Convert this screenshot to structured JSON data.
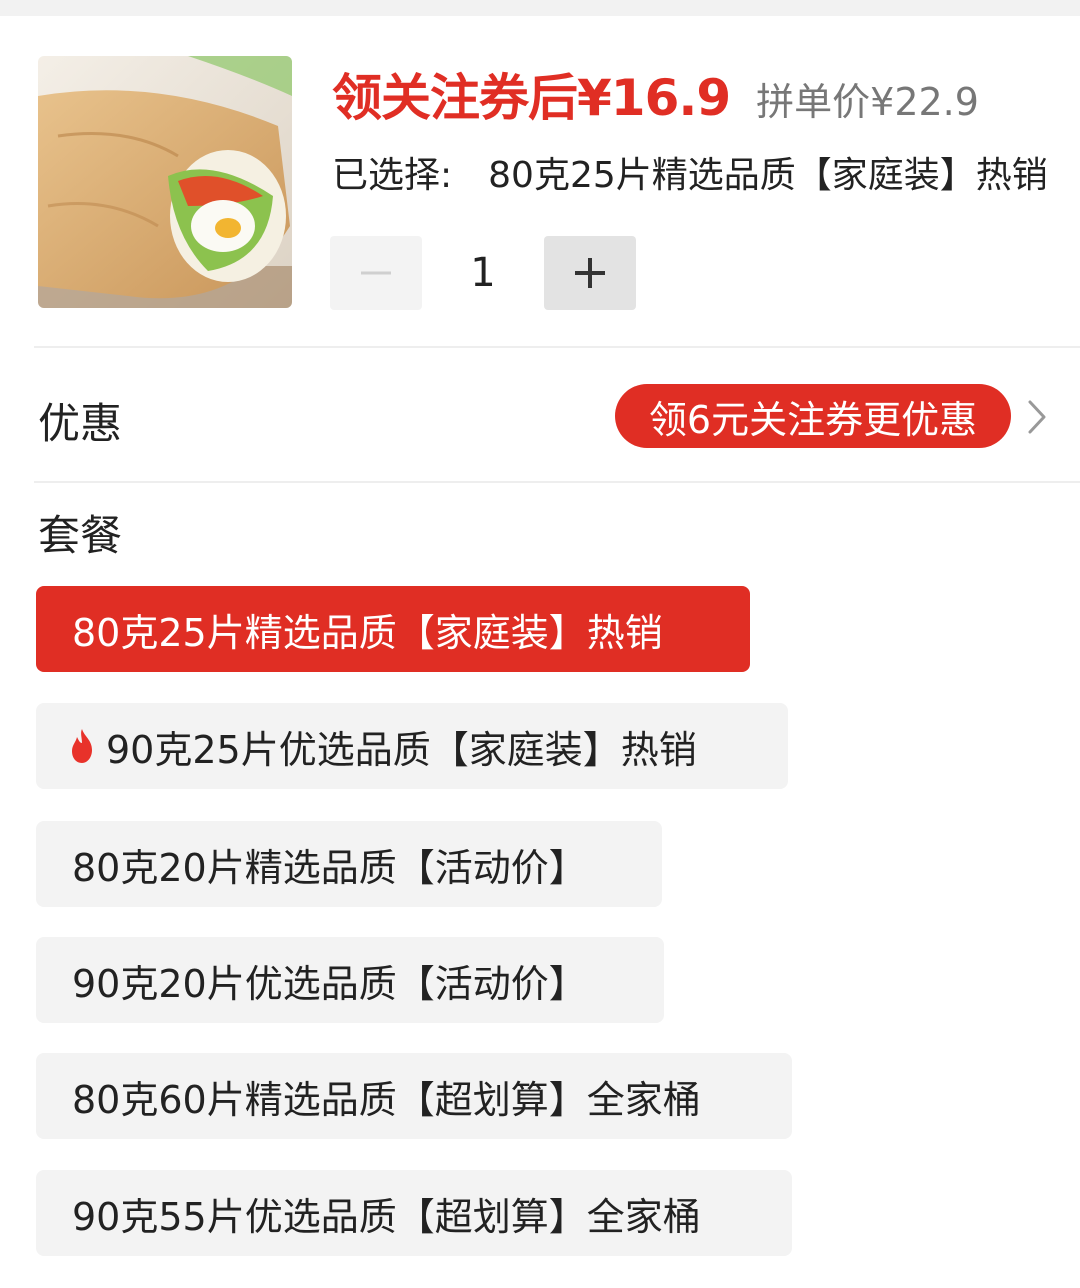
{
  "header": {
    "price_after_coupon": "领关注券后¥16.9",
    "group_price": "拼单价¥22.9",
    "selected_label": "已选择:",
    "selected_value": "80克25片精选品质【家庭装】热销"
  },
  "quantity": {
    "value": "1"
  },
  "promotion": {
    "label": "优惠",
    "badge": "领6元关注券更优惠"
  },
  "package": {
    "title": "套餐",
    "options": [
      {
        "label": "80克25片精选品质【家庭装】热销",
        "selected": true,
        "hot_icon": false
      },
      {
        "label": "90克25片优选品质【家庭装】热销",
        "selected": false,
        "hot_icon": true
      },
      {
        "label": "80克20片精选品质【活动价】",
        "selected": false,
        "hot_icon": false
      },
      {
        "label": "90克20片优选品质【活动价】",
        "selected": false,
        "hot_icon": false
      },
      {
        "label": "80克60片精选品质【超划算】全家桶",
        "selected": false,
        "hot_icon": false
      },
      {
        "label": "90克55片优选品质【超划算】全家桶",
        "selected": false,
        "hot_icon": false
      }
    ]
  },
  "colors": {
    "accent": "#e02e24",
    "option_bg": "#f3f3f3"
  },
  "icons": [
    "minus-icon",
    "plus-icon",
    "chevron-right-icon",
    "flame-icon"
  ]
}
